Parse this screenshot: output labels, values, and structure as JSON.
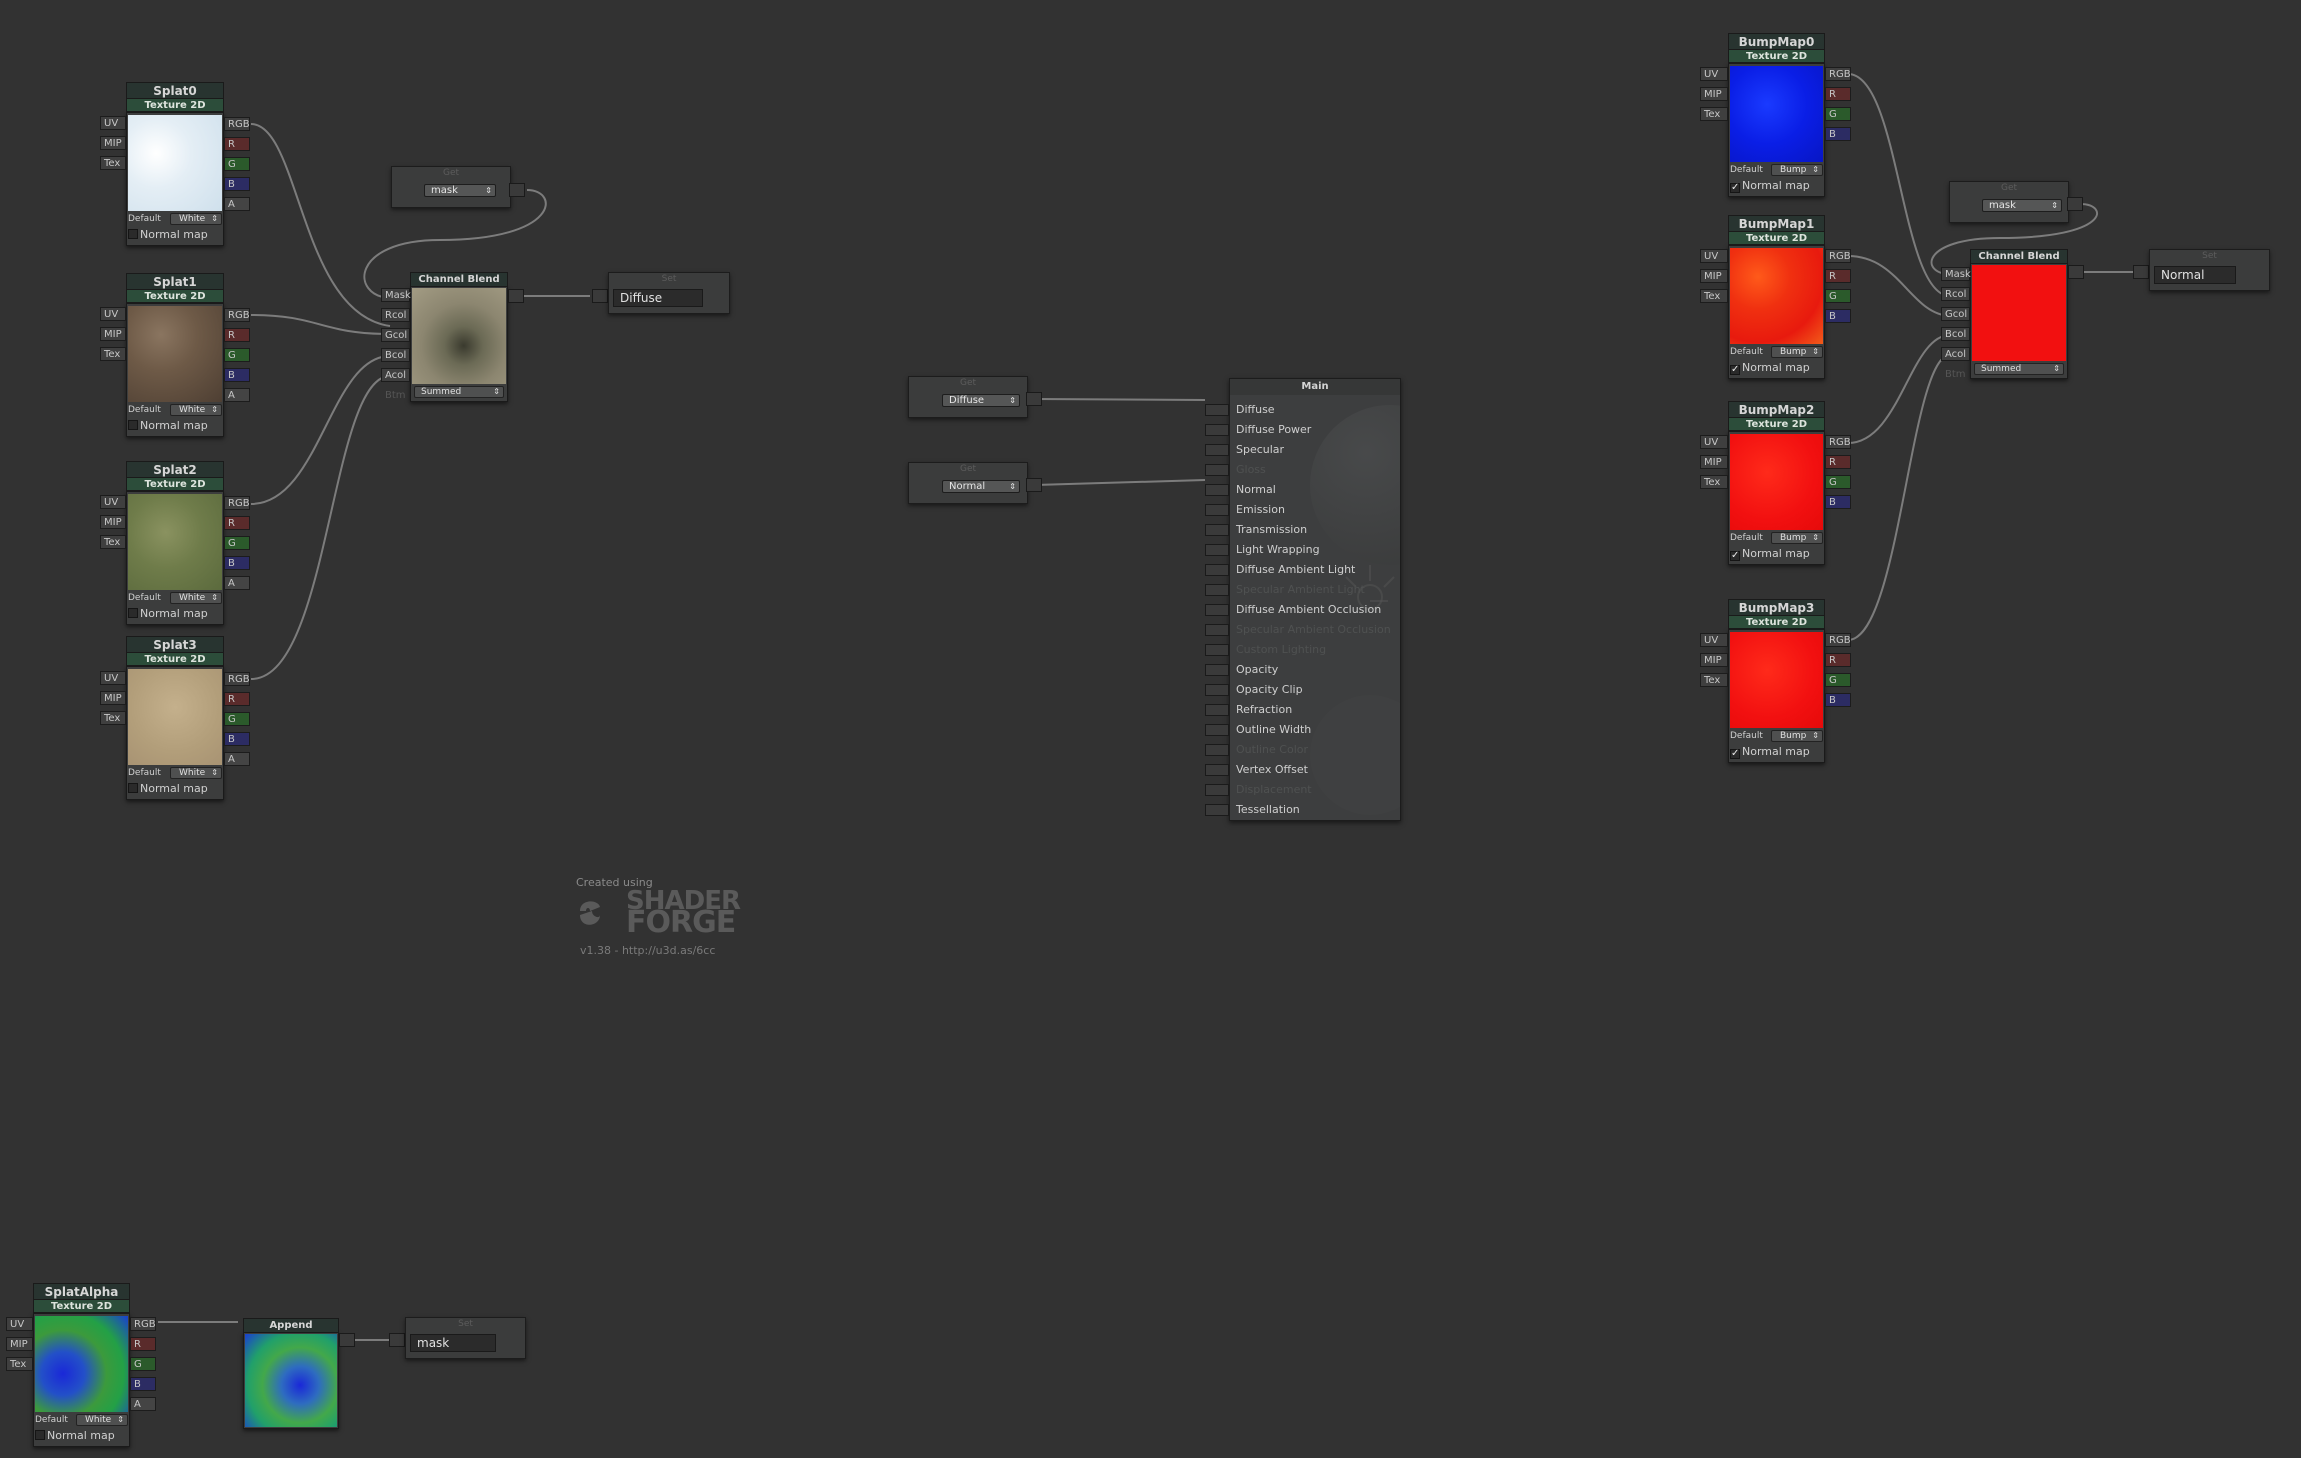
{
  "splat_nodes": [
    {
      "title": "Splat0",
      "type": "Texture 2D",
      "default_label": "Default",
      "default_value": "White",
      "normal_map_label": "Normal map",
      "normal_map_checked": false
    },
    {
      "title": "Splat1",
      "type": "Texture 2D",
      "default_label": "Default",
      "default_value": "White",
      "normal_map_label": "Normal map",
      "normal_map_checked": false
    },
    {
      "title": "Splat2",
      "type": "Texture 2D",
      "default_label": "Default",
      "default_value": "White",
      "normal_map_label": "Normal map",
      "normal_map_checked": false
    },
    {
      "title": "Splat3",
      "type": "Texture 2D",
      "default_label": "Default",
      "default_value": "White",
      "normal_map_label": "Normal map",
      "normal_map_checked": false
    }
  ],
  "bump_nodes": [
    {
      "title": "BumpMap0",
      "type": "Texture 2D",
      "default_label": "Default",
      "default_value": "Bump",
      "normal_map_label": "Normal map",
      "normal_map_checked": true
    },
    {
      "title": "BumpMap1",
      "type": "Texture 2D",
      "default_label": "Default",
      "default_value": "Bump",
      "normal_map_label": "Normal map",
      "normal_map_checked": true
    },
    {
      "title": "BumpMap2",
      "type": "Texture 2D",
      "default_label": "Default",
      "default_value": "Bump",
      "normal_map_label": "Normal map",
      "normal_map_checked": true
    },
    {
      "title": "BumpMap3",
      "type": "Texture 2D",
      "default_label": "Default",
      "default_value": "Bump",
      "normal_map_label": "Normal map",
      "normal_map_checked": true
    }
  ],
  "splat_alpha": {
    "title": "SplatAlpha",
    "type": "Texture 2D",
    "default_label": "Default",
    "default_value": "White",
    "normal_map_label": "Normal map",
    "normal_map_checked": false
  },
  "ports": {
    "inputs": [
      "UV",
      "MIP",
      "Tex"
    ],
    "outputs": [
      "RGB",
      "R",
      "G",
      "B",
      "A"
    ],
    "blend_inputs": [
      "Mask",
      "Rcol",
      "Gcol",
      "Bcol",
      "Acol",
      "Btm"
    ]
  },
  "get_nodes": {
    "title": "Get",
    "left_mask": "mask",
    "right_mask": "mask",
    "diffuse": "Diffuse",
    "normal": "Normal"
  },
  "set_nodes": {
    "title": "Set",
    "diffuse": "Diffuse",
    "normal": "Normal",
    "mask": "mask"
  },
  "channel_blend": {
    "title": "Channel Blend",
    "mode": "Summed"
  },
  "append": {
    "title": "Append"
  },
  "main_node": {
    "title": "Main",
    "inputs": [
      {
        "label": "Diffuse",
        "enabled": true
      },
      {
        "label": "Diffuse Power",
        "enabled": true
      },
      {
        "label": "Specular",
        "enabled": true
      },
      {
        "label": "Gloss",
        "enabled": false
      },
      {
        "label": "Normal",
        "enabled": true
      },
      {
        "label": "Emission",
        "enabled": true
      },
      {
        "label": "Transmission",
        "enabled": true
      },
      {
        "label": "Light Wrapping",
        "enabled": true
      },
      {
        "label": "Diffuse Ambient Light",
        "enabled": true
      },
      {
        "label": "Specular Ambient Light",
        "enabled": false
      },
      {
        "label": "Diffuse Ambient Occlusion",
        "enabled": true
      },
      {
        "label": "Specular Ambient Occlusion",
        "enabled": false
      },
      {
        "label": "Custom Lighting",
        "enabled": false
      },
      {
        "label": "Opacity",
        "enabled": true
      },
      {
        "label": "Opacity Clip",
        "enabled": true
      },
      {
        "label": "Refraction",
        "enabled": true
      },
      {
        "label": "Outline Width",
        "enabled": true
      },
      {
        "label": "Outline Color",
        "enabled": false
      },
      {
        "label": "Vertex Offset",
        "enabled": true
      },
      {
        "label": "Displacement",
        "enabled": false
      },
      {
        "label": "Tessellation",
        "enabled": true
      }
    ]
  },
  "credits": {
    "created_using": "Created using",
    "logo_line1": "SHADER",
    "logo_line2": "FORGE",
    "version": "v1.38 - http://u3d.as/6cc"
  },
  "colors": {
    "background": "#323232",
    "node_title": "#283430",
    "node_subtitle": "#2c4d3a",
    "bump_blue": "#0a1ee6",
    "bump_red": "#f21010",
    "wire": "#8c8c8c"
  }
}
